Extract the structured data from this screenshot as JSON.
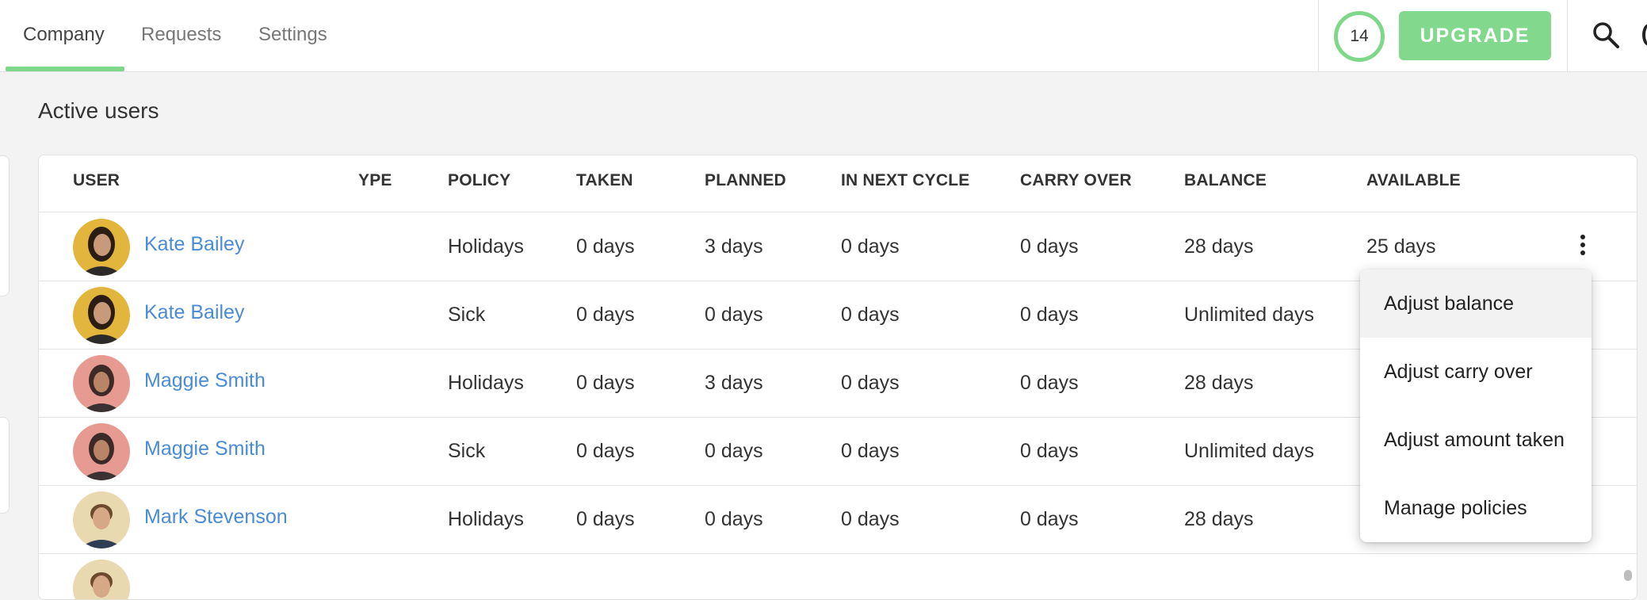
{
  "nav": {
    "tabs": [
      {
        "label": "Company",
        "active": true
      },
      {
        "label": "Requests",
        "active": false
      },
      {
        "label": "Settings",
        "active": false
      }
    ],
    "counter": "14",
    "upgrade_label": "UPGRADE",
    "accent_color": "#7fd88a"
  },
  "page": {
    "title": "Active users"
  },
  "table": {
    "headers": {
      "user": "USER",
      "type": "YPE",
      "policy": "POLICY",
      "taken": "TAKEN",
      "planned": "PLANNED",
      "next": "IN NEXT CYCLE",
      "carry": "CARRY OVER",
      "balance": "BALANCE",
      "available": "AVAILABLE"
    },
    "rows": [
      {
        "name": "Kate Bailey",
        "policy": "Holidays",
        "taken": "0 days",
        "planned": "3 days",
        "next": "0 days",
        "carry": "0 days",
        "balance": "28 days",
        "available": "25 days"
      },
      {
        "name": "Kate Bailey",
        "policy": "Sick",
        "taken": "0 days",
        "planned": "0 days",
        "next": "0 days",
        "carry": "0 days",
        "balance": "Unlimited days",
        "available": ""
      },
      {
        "name": "Maggie Smith",
        "policy": "Holidays",
        "taken": "0 days",
        "planned": "3 days",
        "next": "0 days",
        "carry": "0 days",
        "balance": "28 days",
        "available": ""
      },
      {
        "name": "Maggie Smith",
        "policy": "Sick",
        "taken": "0 days",
        "planned": "0 days",
        "next": "0 days",
        "carry": "0 days",
        "balance": "Unlimited days",
        "available": ""
      },
      {
        "name": "Mark Stevenson",
        "policy": "Holidays",
        "taken": "0 days",
        "planned": "0 days",
        "next": "0 days",
        "carry": "0 days",
        "balance": "28 days",
        "available": ""
      }
    ]
  },
  "menu": {
    "items": [
      "Adjust balance",
      "Adjust carry over",
      "Adjust amount taken",
      "Manage policies"
    ]
  }
}
